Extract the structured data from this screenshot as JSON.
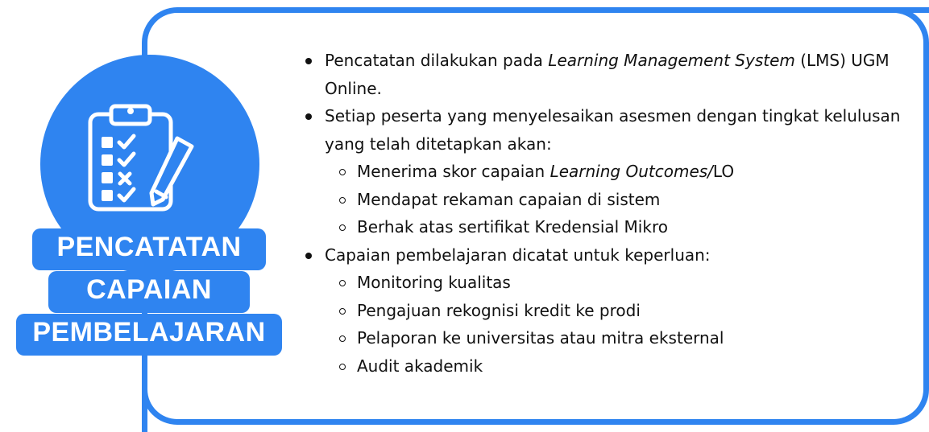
{
  "heading": {
    "line1": "PENCATATAN",
    "line2": "CAPAIAN",
    "line3": "PEMBELAJARAN"
  },
  "icon": "clipboard-checklist-icon",
  "colors": {
    "accent": "#2f84f0",
    "text": "#111111"
  },
  "bullets": [
    {
      "pre": "Pencatatan dilakukan pada ",
      "italic": "Learning Management System",
      "post": " (LMS) UGM Online."
    },
    {
      "text": "Setiap peserta yang menyelesaikan asesmen dengan tingkat kelulusan yang telah ditetapkan akan:",
      "sub": [
        {
          "pre": "Menerima skor capaian ",
          "italic": "Learning Outcomes/",
          "post": "LO"
        },
        {
          "text": "Mendapat rekaman capaian di sistem"
        },
        {
          "text": "Berhak atas sertifikat Kredensial Mikro"
        }
      ]
    },
    {
      "text": "Capaian pembelajaran dicatat untuk keperluan:",
      "sub": [
        {
          "text": "Monitoring kualitas"
        },
        {
          "text": "Pengajuan rekognisi kredit ke prodi"
        },
        {
          "text": "Pelaporan ke universitas atau mitra eksternal"
        },
        {
          "text": "Audit akademik"
        }
      ]
    }
  ]
}
